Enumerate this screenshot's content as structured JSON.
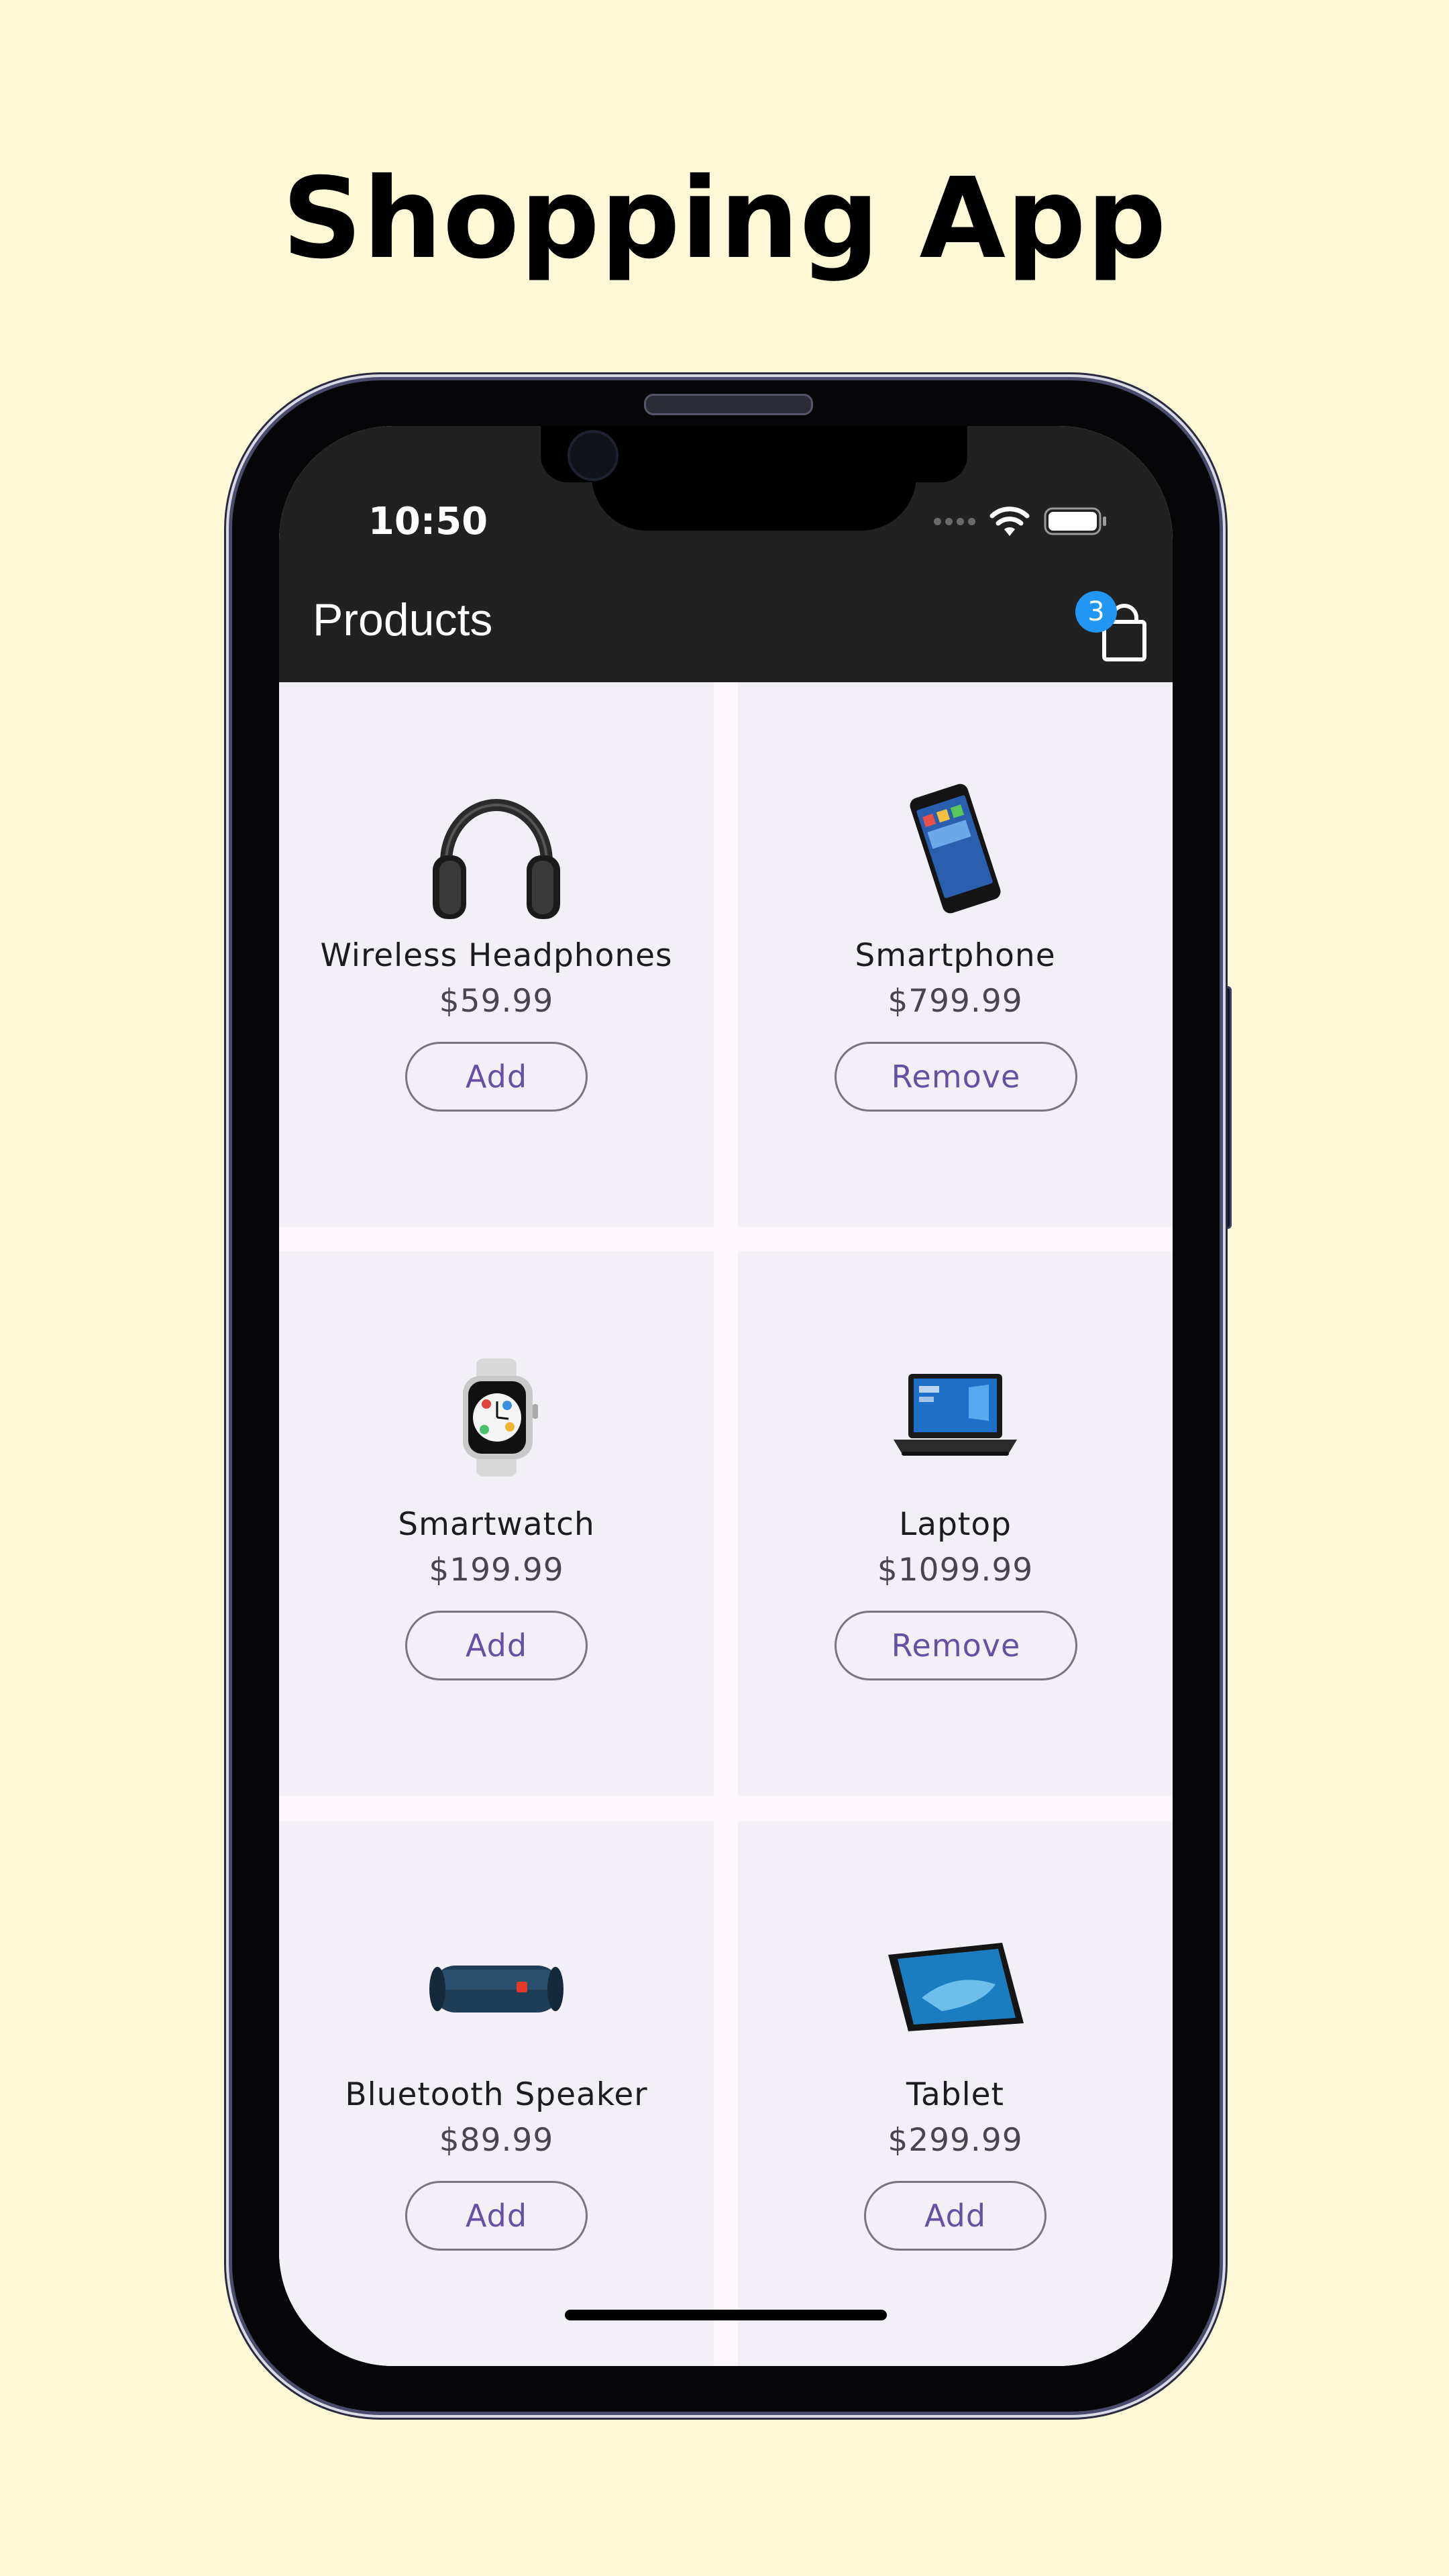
{
  "headline": "Shopping App",
  "status_bar": {
    "time": "10:50"
  },
  "app_bar": {
    "title": "Products",
    "cart_count": "3"
  },
  "products": [
    {
      "name": "Wireless Headphones",
      "price": "$59.99",
      "action": "Add",
      "icon": "headphones-image"
    },
    {
      "name": "Smartphone",
      "price": "$799.99",
      "action": "Remove",
      "icon": "smartphone-image"
    },
    {
      "name": "Smartwatch",
      "price": "$199.99",
      "action": "Add",
      "icon": "smartwatch-image"
    },
    {
      "name": "Laptop",
      "price": "$1099.99",
      "action": "Remove",
      "icon": "laptop-image"
    },
    {
      "name": "Bluetooth Speaker",
      "price": "$89.99",
      "action": "Add",
      "icon": "speaker-image"
    },
    {
      "name": "Tablet",
      "price": "$299.99",
      "action": "Add",
      "icon": "tablet-image"
    }
  ],
  "colors": {
    "background": "#fdf8d6",
    "app_bar": "#212121",
    "accent": "#6750a4",
    "badge": "#2196f3"
  }
}
